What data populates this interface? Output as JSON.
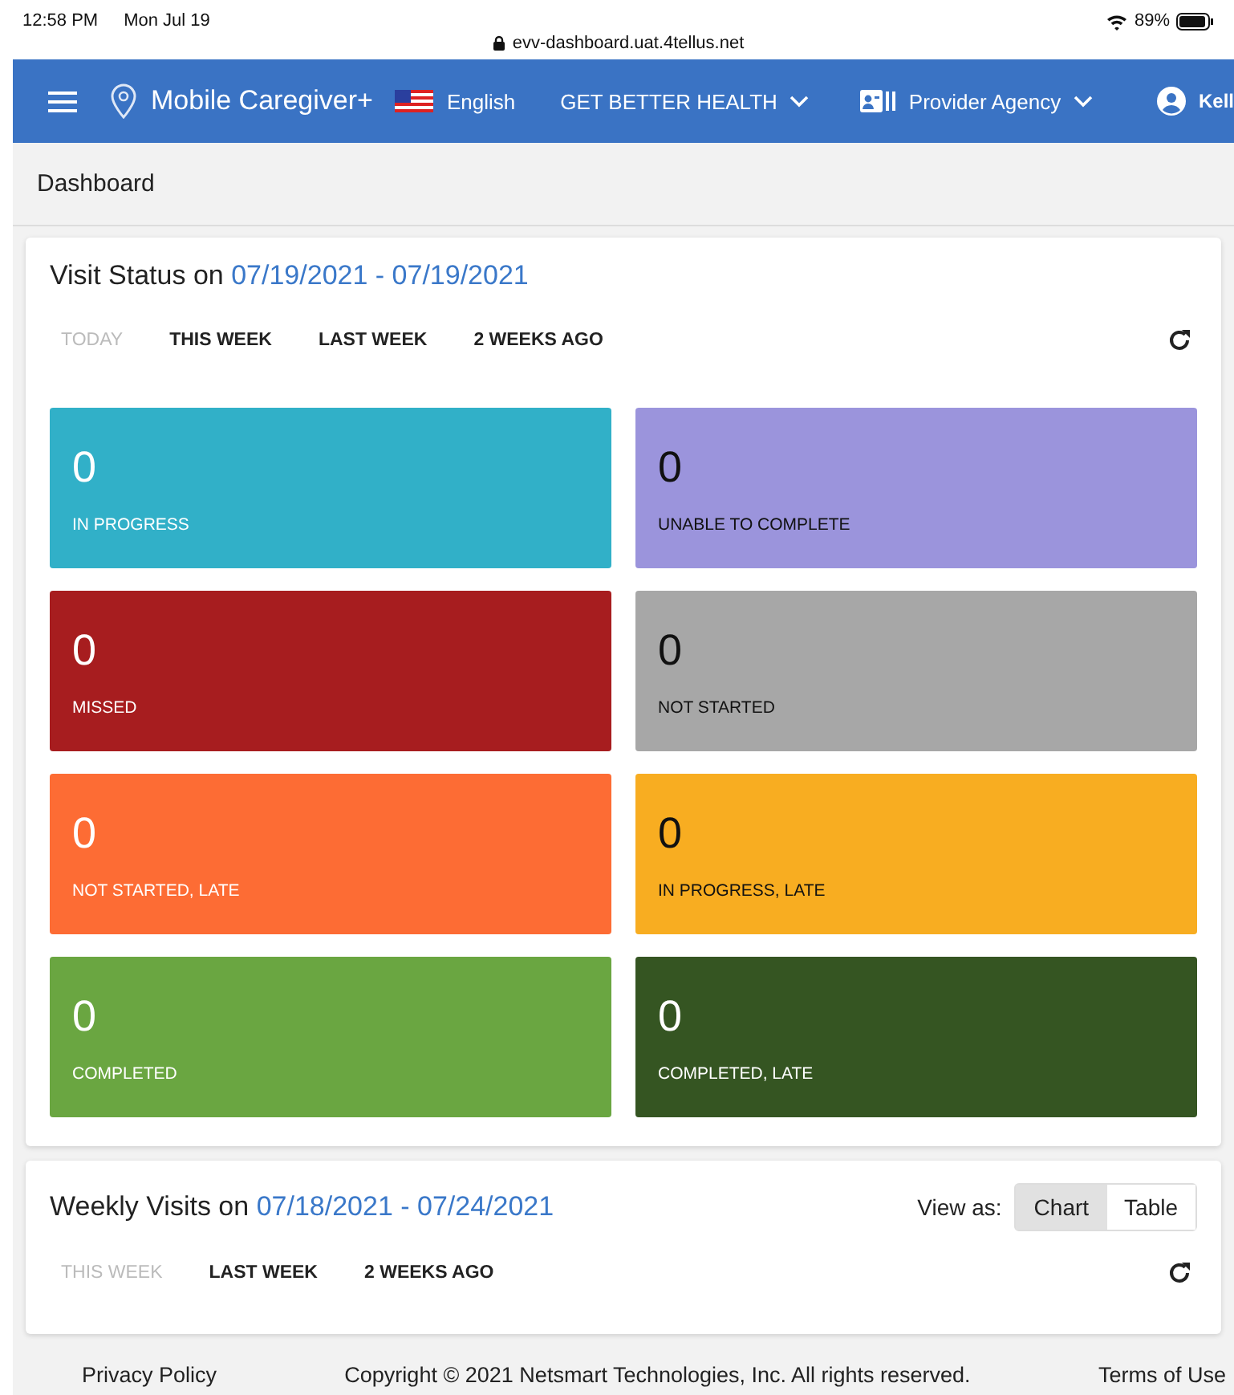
{
  "status_bar": {
    "time": "12:58 PM",
    "date": "Mon Jul 19",
    "url": "evv-dashboard.uat.4tellus.net",
    "battery": "89%"
  },
  "navbar": {
    "app_name": "Mobile Caregiver+",
    "language": "English",
    "menus": [
      {
        "label": "GET BETTER HEALTH",
        "kind": "dropdown"
      },
      {
        "label": "Provider Agency",
        "kind": "agency"
      }
    ],
    "user": "Kell"
  },
  "breadcrumb": "Dashboard",
  "visit_status": {
    "title": "Visit Status on",
    "range": "07/19/2021 - 07/19/2021",
    "tabs": [
      {
        "label": "TODAY",
        "selected": true
      },
      {
        "label": "THIS WEEK",
        "selected": false
      },
      {
        "label": "LAST WEEK",
        "selected": false
      },
      {
        "label": "2 WEEKS AGO",
        "selected": false
      }
    ],
    "tiles": [
      {
        "count": "0",
        "label": "IN PROGRESS",
        "color": "#31b0c8"
      },
      {
        "count": "0",
        "label": "UNABLE TO COMPLETE",
        "color": "#9b94dc"
      },
      {
        "count": "0",
        "label": "MISSED",
        "color": "#a71d1f"
      },
      {
        "count": "0",
        "label": "NOT STARTED",
        "color": "#a7a7a7"
      },
      {
        "count": "0",
        "label": "NOT STARTED, LATE",
        "color": "#fd6c34"
      },
      {
        "count": "0",
        "label": "IN PROGRESS, LATE",
        "color": "#f8ad21"
      },
      {
        "count": "0",
        "label": "COMPLETED",
        "color": "#6aa641"
      },
      {
        "count": "0",
        "label": "COMPLETED, LATE",
        "color": "#355522"
      }
    ]
  },
  "weekly_visits": {
    "title": "Weekly Visits on",
    "range": "07/18/2021 - 07/24/2021",
    "view_label": "View as:",
    "view_options": [
      {
        "label": "Chart",
        "selected": true
      },
      {
        "label": "Table",
        "selected": false
      }
    ],
    "tabs": [
      {
        "label": "THIS WEEK",
        "selected": true
      },
      {
        "label": "LAST WEEK",
        "selected": false
      },
      {
        "label": "2 WEEKS AGO",
        "selected": false
      }
    ]
  },
  "footer": {
    "privacy": "Privacy Policy",
    "copyright": "Copyright © 2021 Netsmart Technologies, Inc. All rights reserved.",
    "terms": "Terms of Use"
  }
}
